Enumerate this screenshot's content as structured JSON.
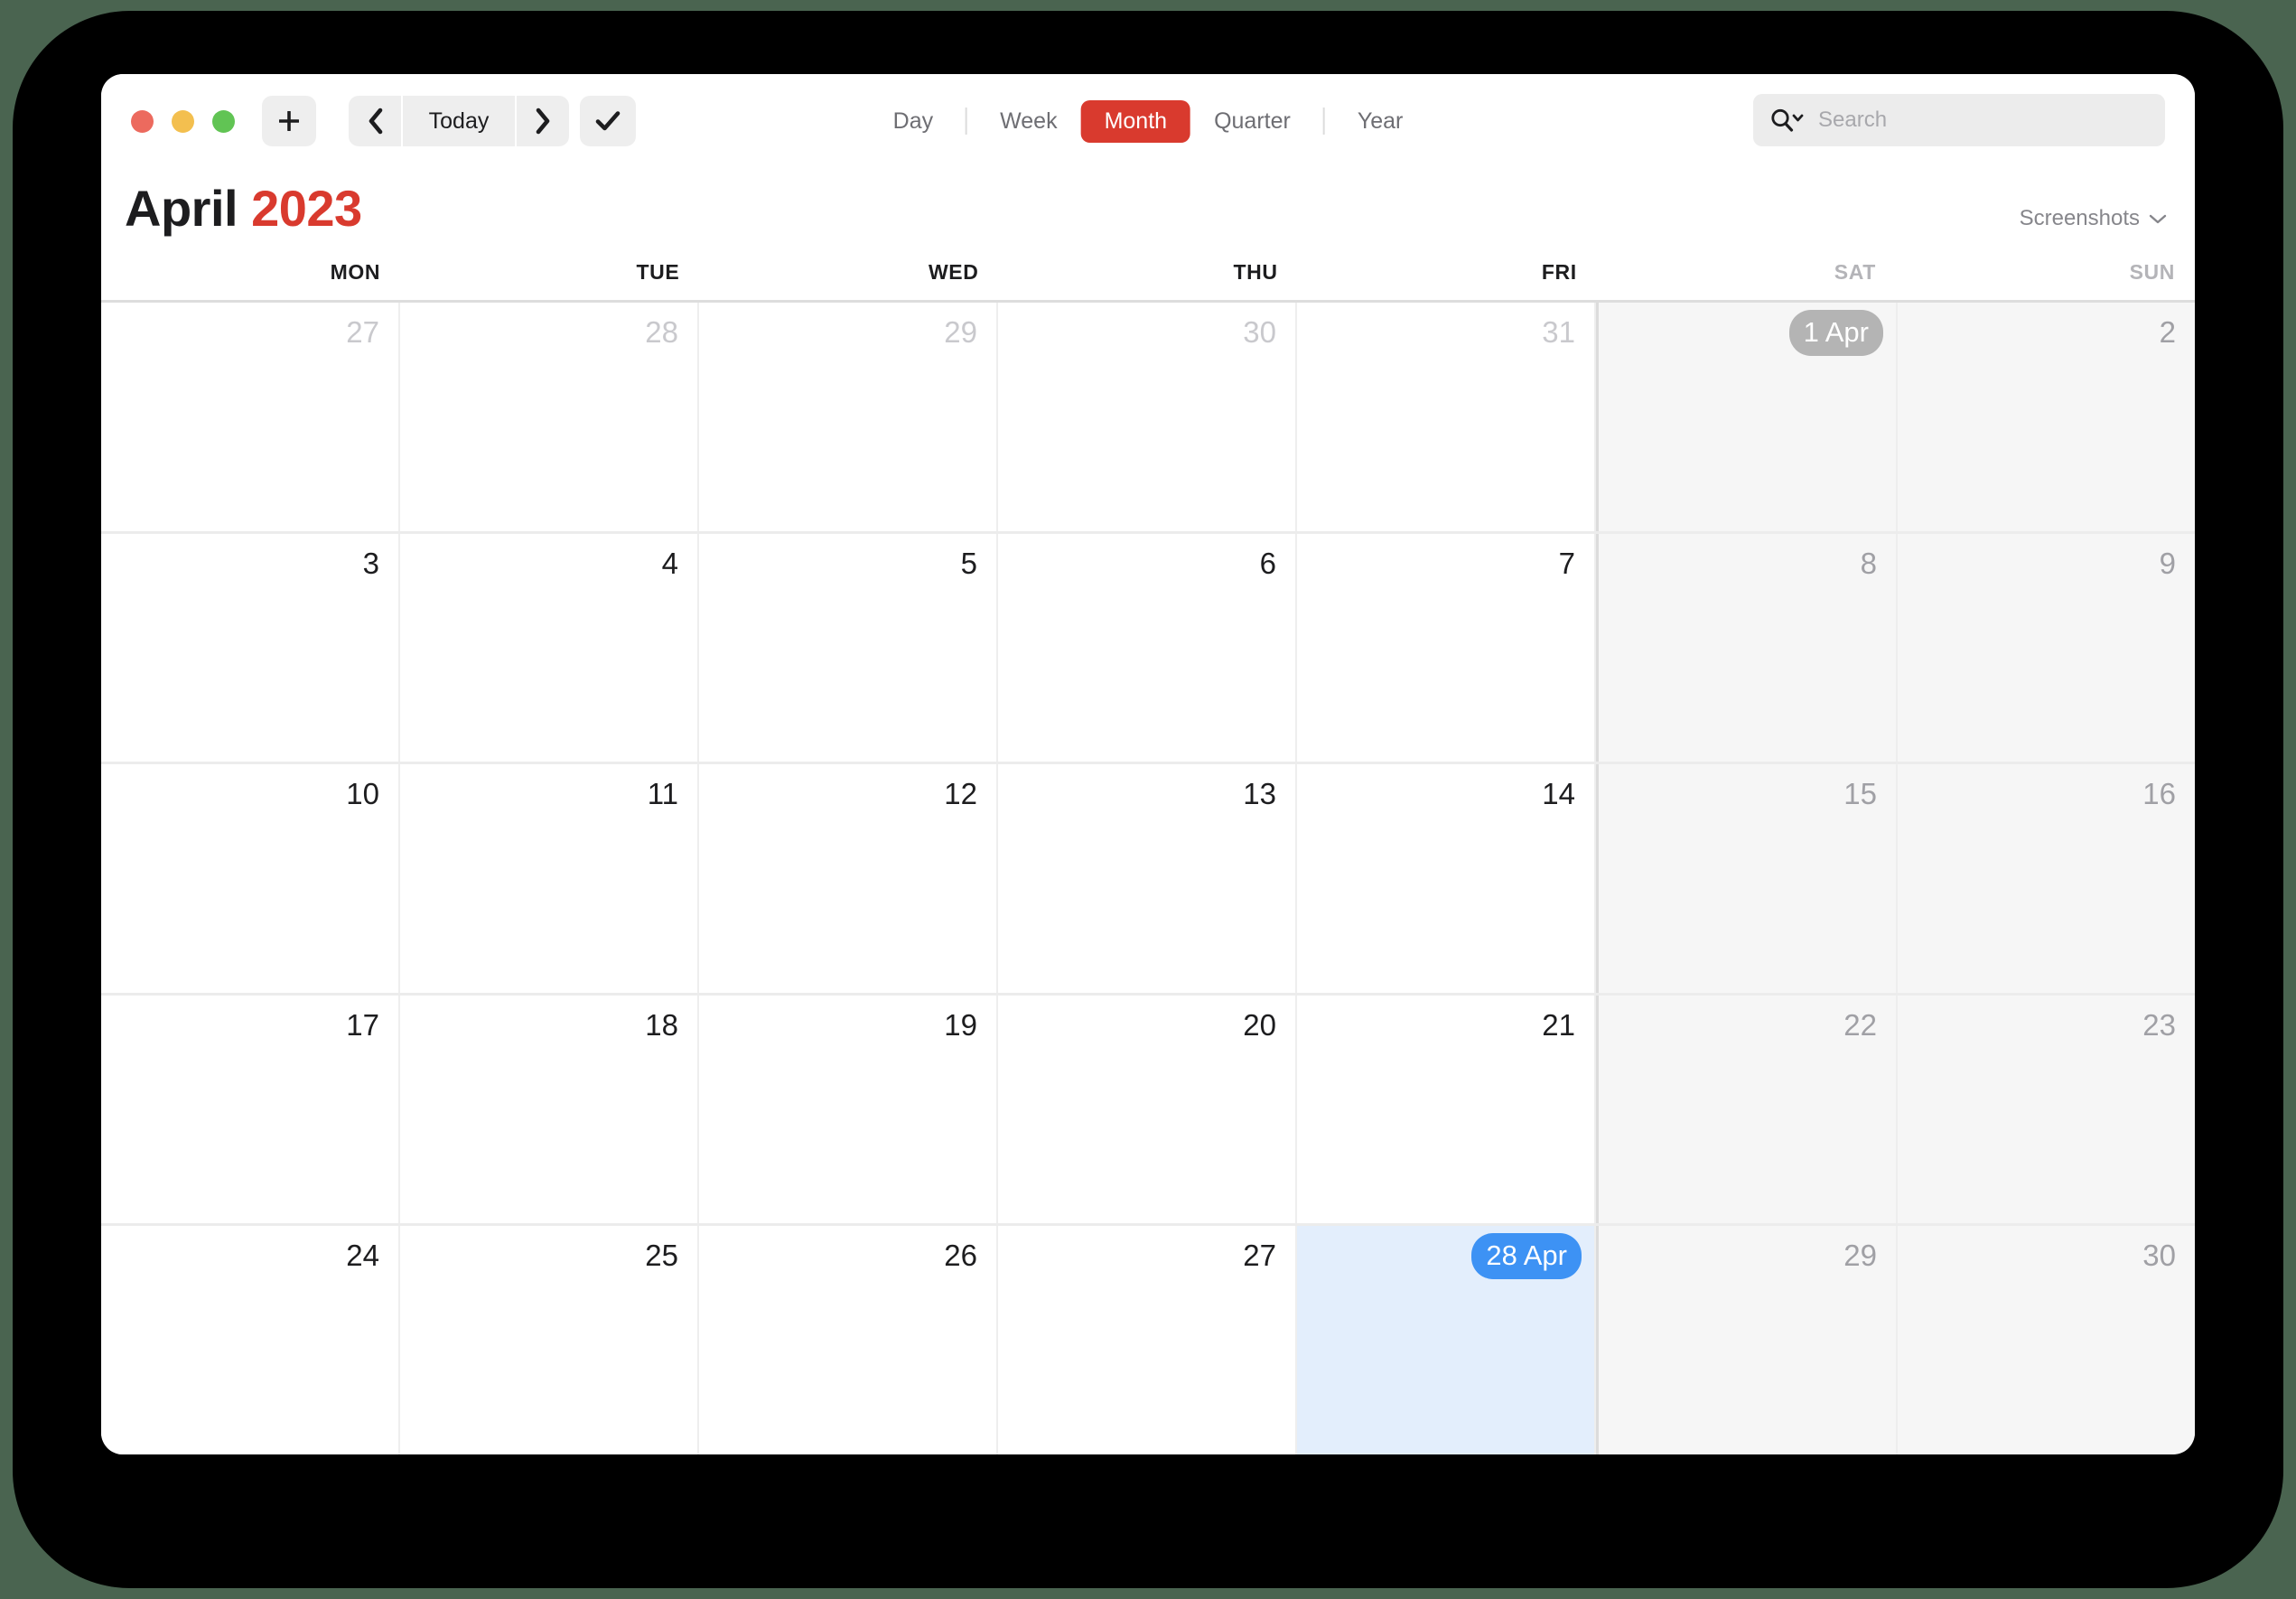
{
  "window": {
    "traffic_lights": [
      {
        "name": "close",
        "color": "#ec6a5e"
      },
      {
        "name": "minimize",
        "color": "#f3bf4f"
      },
      {
        "name": "zoom",
        "color": "#61c454"
      }
    ]
  },
  "toolbar": {
    "add_label": "+",
    "prev_label": "‹",
    "today_label": "Today",
    "next_label": "›",
    "check_label": "✓",
    "views": [
      {
        "label": "Day",
        "active": false
      },
      {
        "label": "Week",
        "active": false
      },
      {
        "label": "Month",
        "active": true
      },
      {
        "label": "Quarter",
        "active": false
      },
      {
        "label": "Year",
        "active": false
      }
    ],
    "search": {
      "placeholder": "Search",
      "value": ""
    }
  },
  "header": {
    "month": "April",
    "year": "2023",
    "calendar_selector": "Screenshots"
  },
  "colors": {
    "accent_red": "#d93a2e",
    "selection_blue": "#3d92f4",
    "selection_cell": "#e3eefc",
    "today_badge_gray": "#b4b4b4",
    "weekend_bg": "#f6f6f6",
    "desktop_green": "#4a6450"
  },
  "weekdays": [
    {
      "label": "MON",
      "weekend": false
    },
    {
      "label": "TUE",
      "weekend": false
    },
    {
      "label": "WED",
      "weekend": false
    },
    {
      "label": "THU",
      "weekend": false
    },
    {
      "label": "FRI",
      "weekend": false
    },
    {
      "label": "SAT",
      "weekend": true
    },
    {
      "label": "SUN",
      "weekend": true
    }
  ],
  "weeks": [
    [
      {
        "label": "27",
        "muted": true,
        "weekend": false,
        "badge": null,
        "selected": false
      },
      {
        "label": "28",
        "muted": true,
        "weekend": false,
        "badge": null,
        "selected": false
      },
      {
        "label": "29",
        "muted": true,
        "weekend": false,
        "badge": null,
        "selected": false
      },
      {
        "label": "30",
        "muted": true,
        "weekend": false,
        "badge": null,
        "selected": false
      },
      {
        "label": "31",
        "muted": true,
        "weekend": false,
        "badge": null,
        "selected": false
      },
      {
        "label": "1 Apr",
        "muted": false,
        "weekend": true,
        "badge": "gray",
        "selected": false
      },
      {
        "label": "2",
        "muted": false,
        "weekend": true,
        "badge": null,
        "selected": false
      }
    ],
    [
      {
        "label": "3",
        "muted": false,
        "weekend": false,
        "badge": null,
        "selected": false
      },
      {
        "label": "4",
        "muted": false,
        "weekend": false,
        "badge": null,
        "selected": false
      },
      {
        "label": "5",
        "muted": false,
        "weekend": false,
        "badge": null,
        "selected": false
      },
      {
        "label": "6",
        "muted": false,
        "weekend": false,
        "badge": null,
        "selected": false
      },
      {
        "label": "7",
        "muted": false,
        "weekend": false,
        "badge": null,
        "selected": false
      },
      {
        "label": "8",
        "muted": false,
        "weekend": true,
        "badge": null,
        "selected": false
      },
      {
        "label": "9",
        "muted": false,
        "weekend": true,
        "badge": null,
        "selected": false
      }
    ],
    [
      {
        "label": "10",
        "muted": false,
        "weekend": false,
        "badge": null,
        "selected": false
      },
      {
        "label": "11",
        "muted": false,
        "weekend": false,
        "badge": null,
        "selected": false
      },
      {
        "label": "12",
        "muted": false,
        "weekend": false,
        "badge": null,
        "selected": false
      },
      {
        "label": "13",
        "muted": false,
        "weekend": false,
        "badge": null,
        "selected": false
      },
      {
        "label": "14",
        "muted": false,
        "weekend": false,
        "badge": null,
        "selected": false
      },
      {
        "label": "15",
        "muted": false,
        "weekend": true,
        "badge": null,
        "selected": false
      },
      {
        "label": "16",
        "muted": false,
        "weekend": true,
        "badge": null,
        "selected": false
      }
    ],
    [
      {
        "label": "17",
        "muted": false,
        "weekend": false,
        "badge": null,
        "selected": false
      },
      {
        "label": "18",
        "muted": false,
        "weekend": false,
        "badge": null,
        "selected": false
      },
      {
        "label": "19",
        "muted": false,
        "weekend": false,
        "badge": null,
        "selected": false
      },
      {
        "label": "20",
        "muted": false,
        "weekend": false,
        "badge": null,
        "selected": false
      },
      {
        "label": "21",
        "muted": false,
        "weekend": false,
        "badge": null,
        "selected": false
      },
      {
        "label": "22",
        "muted": false,
        "weekend": true,
        "badge": null,
        "selected": false
      },
      {
        "label": "23",
        "muted": false,
        "weekend": true,
        "badge": null,
        "selected": false
      }
    ],
    [
      {
        "label": "24",
        "muted": false,
        "weekend": false,
        "badge": null,
        "selected": false
      },
      {
        "label": "25",
        "muted": false,
        "weekend": false,
        "badge": null,
        "selected": false
      },
      {
        "label": "26",
        "muted": false,
        "weekend": false,
        "badge": null,
        "selected": false
      },
      {
        "label": "27",
        "muted": false,
        "weekend": false,
        "badge": null,
        "selected": false
      },
      {
        "label": "28 Apr",
        "muted": false,
        "weekend": false,
        "badge": "blue",
        "selected": true
      },
      {
        "label": "29",
        "muted": false,
        "weekend": true,
        "badge": null,
        "selected": false
      },
      {
        "label": "30",
        "muted": false,
        "weekend": true,
        "badge": null,
        "selected": false
      }
    ]
  ]
}
